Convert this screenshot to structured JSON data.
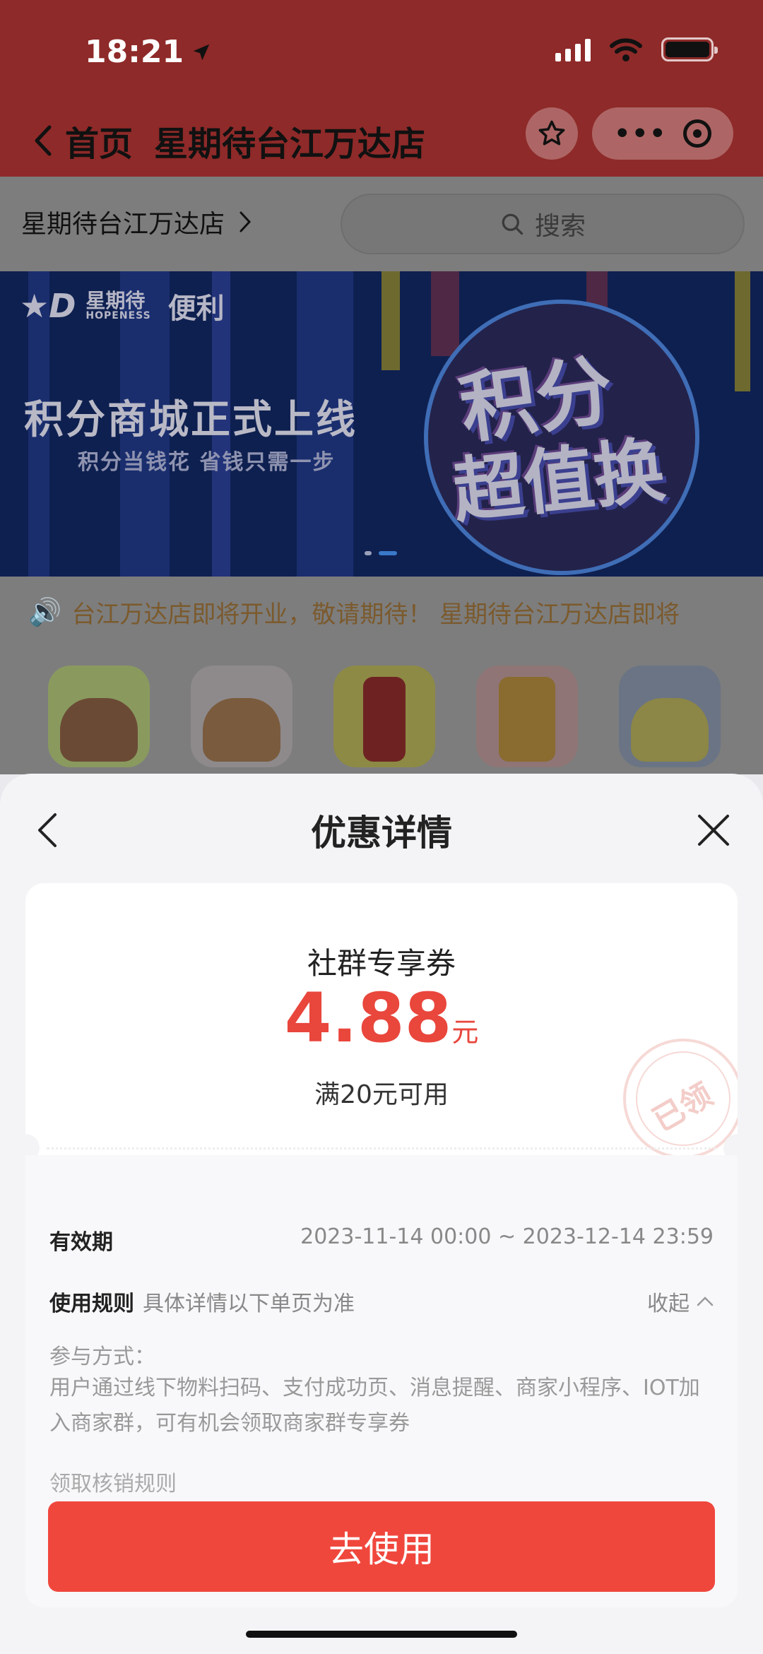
{
  "status": {
    "time": "18:21"
  },
  "nav": {
    "back_label": "首页",
    "title": "星期待台江万达店"
  },
  "store": {
    "name": "星期待台江万达店"
  },
  "search": {
    "placeholder": "搜索"
  },
  "banner": {
    "brand_cn": "星期待",
    "brand_en": "HOPENESS",
    "category": "便利",
    "headline": "积分商城正式上线",
    "subline": "积分当钱花 省钱只需一步",
    "art_line1": "积分",
    "art_line2": "超值换"
  },
  "notice": {
    "text": "台江万达店即将开业，敬请期待！   星期待台江万达店即将"
  },
  "categories": [
    {
      "icon": "meal-icon"
    },
    {
      "icon": "noodle-icon"
    },
    {
      "icon": "cola-icon"
    },
    {
      "icon": "drinks-icon"
    },
    {
      "icon": "snacks-icon"
    }
  ],
  "sheet": {
    "title": "优惠详情",
    "coupon": {
      "name": "社群专享券",
      "amount": "4.88",
      "unit": "元",
      "condition": "满20元可用",
      "stamp": "已领"
    },
    "validity_label": "有效期",
    "validity_value": "2023-11-14 00:00 ~ 2023-12-14 23:59",
    "rules_label": "使用规则",
    "rules_hint": "具体详情以下单页为准",
    "collapse_label": "收起",
    "join_heading": "参与方式：",
    "join_text": "用户通过线下物料扫码、支付成功页、消息提醒、商家小程序、IOT加入商家群，可有机会领取商家群专享券",
    "redeem_heading": "领取核销规则",
    "use_button": "去使用"
  },
  "colors": {
    "accent": "#f0473d",
    "nav_bg": "#8e2a29",
    "price": "#e9463c"
  }
}
